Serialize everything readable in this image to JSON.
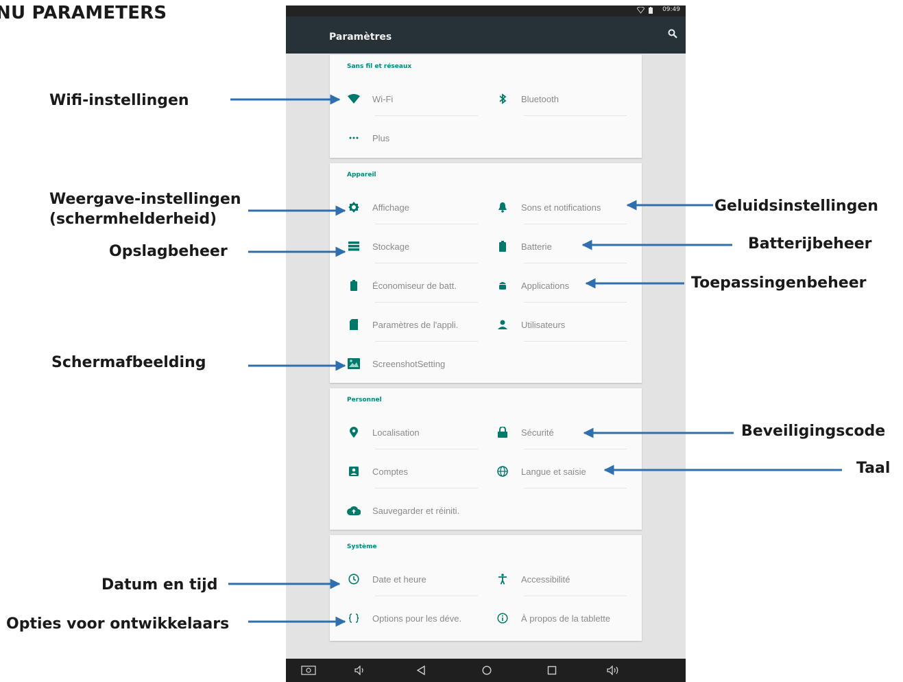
{
  "heading": "NU PARAMETERS",
  "status": {
    "time": "09:49"
  },
  "appbar": {
    "title": "Paramètres"
  },
  "sections": {
    "wireless": {
      "title": "Sans fil et réseaux",
      "wifi": "Wi-Fi",
      "bluetooth": "Bluetooth",
      "more": "Plus"
    },
    "device": {
      "title": "Appareil",
      "display": "Affichage",
      "sound": "Sons et notifications",
      "storage": "Stockage",
      "battery": "Batterie",
      "battery_saver": "Économiseur de batt.",
      "apps": "Applications",
      "app_settings": "Paramètres de l'appli.",
      "users": "Utilisateurs",
      "screenshot": "ScreenshotSetting"
    },
    "personal": {
      "title": "Personnel",
      "location": "Localisation",
      "security": "Sécurité",
      "accounts": "Comptes",
      "language": "Langue et saisie",
      "backup": "Sauvegarder et réiniti."
    },
    "system": {
      "title": "Système",
      "datetime": "Date et heure",
      "accessibility": "Accessibilité",
      "developer": "Options pour les déve.",
      "about": "À propos de la tablette"
    }
  },
  "annotations": {
    "wifi": "Wifi-instellingen",
    "display_line1": "Weergave-instellingen",
    "display_line2": "(schermhelderheid)",
    "storage": "Opslagbeheer",
    "screenshot": "Schermafbeelding",
    "datetime": "Datum en tijd",
    "developer": "Opties voor ontwikkelaars",
    "sound": "Geluidsinstellingen",
    "battery": "Batterijbeheer",
    "apps": "Toepassingenbeheer",
    "security": "Beveiligingscode",
    "language": "Taal"
  },
  "colors": {
    "accent": "#00897b",
    "appbar": "#263238",
    "arrow": "#2f6fb0",
    "icon": "#00796b"
  }
}
